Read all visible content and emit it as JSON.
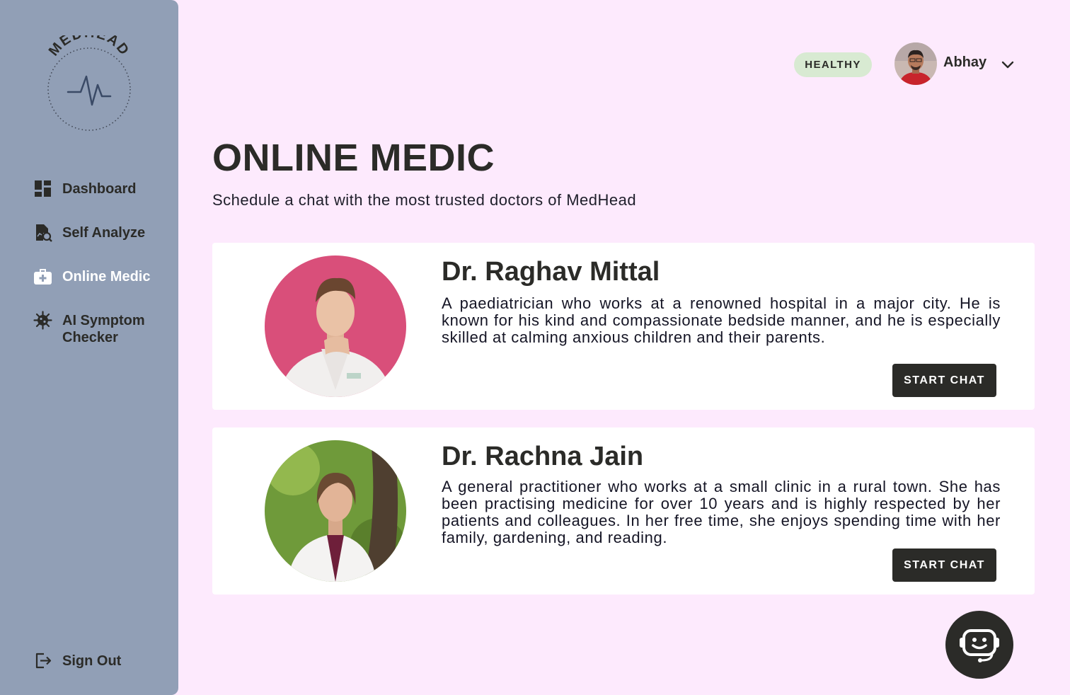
{
  "app": {
    "logo_text": "MEDHEAD"
  },
  "sidebar": {
    "items": [
      {
        "label": "Dashboard",
        "icon": "dashboard-icon"
      },
      {
        "label": "Self Analyze",
        "icon": "analyze-icon"
      },
      {
        "label": "Online Medic",
        "icon": "medical-kit-icon",
        "active": true
      },
      {
        "label": "AI Symptom Checker",
        "icon": "virus-icon"
      }
    ],
    "sign_out": {
      "label": "Sign Out",
      "icon": "sign-out-icon"
    }
  },
  "header": {
    "status_badge": "HEALTHY",
    "user_name": "Abhay"
  },
  "main": {
    "title": "ONLINE MEDIC",
    "subtitle": "Schedule a chat with the most trusted doctors of MedHead"
  },
  "doctors": [
    {
      "name": "Dr. Raghav Mittal",
      "description": "A paediatrician who works at a renowned hospital in a major city. He is known for his kind and compassionate bedside manner, and he is especially skilled at calming anxious children and their parents.",
      "button_label": "START CHAT"
    },
    {
      "name": "Dr. Rachna Jain",
      "description": "A general practitioner who works at a small clinic in a rural town. She has been practising medicine for over 10 years and is highly respected by her patients and colleagues. In her free time, she enjoys spending time with her family, gardening, and reading.",
      "button_label": "START CHAT"
    }
  ],
  "colors": {
    "page_background": "#fdeafd",
    "sidebar_background": "#919fb6",
    "text_dark": "#2b2b28",
    "badge_background": "#d8ead2",
    "button_background": "#2b2b28"
  }
}
